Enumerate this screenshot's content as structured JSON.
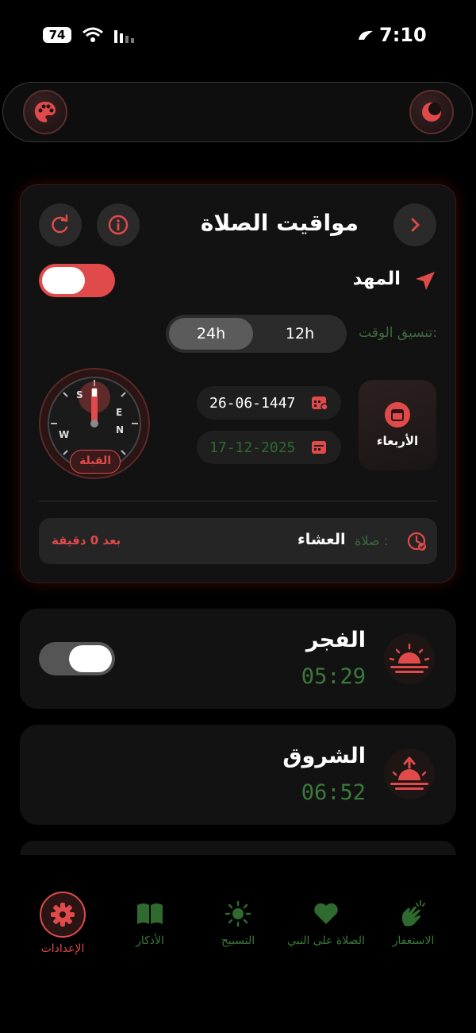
{
  "status_bar": {
    "battery": "74",
    "time": "7:10"
  },
  "header": {
    "title": "مواقيت الصلاة"
  },
  "location": {
    "name": "المهد",
    "auto_enabled": true
  },
  "time_format": {
    "label": "تنسيق الوقت:",
    "option_24": "24h",
    "option_12": "12h",
    "selected": "24h"
  },
  "dates": {
    "hijri": "26-06-1447",
    "gregorian": "17-12-2025",
    "weekday": "الأربعاء"
  },
  "qibla": {
    "label": "القبلة",
    "directions": [
      "S",
      "E",
      "N",
      "W"
    ]
  },
  "next_prayer": {
    "label": "صلاة :",
    "name": "العشاء",
    "remaining": "بعد 0 دقيقة"
  },
  "prayers": [
    {
      "name": "الفجر",
      "time": "05:29",
      "alert_on": true
    },
    {
      "name": "الشروق",
      "time": "06:52"
    }
  ],
  "bottom_nav": [
    {
      "label": "الإعدادات",
      "icon": "gear-icon",
      "active": true
    },
    {
      "label": "الأذكار",
      "icon": "book-icon"
    },
    {
      "label": "التسبيح",
      "icon": "sun-icon"
    },
    {
      "label": "الصلاة على النبي",
      "icon": "heart-icon"
    },
    {
      "label": "الاستغفار",
      "icon": "hands-icon"
    }
  ],
  "colors": {
    "accent": "#e04a4a",
    "green": "#3a7a3a",
    "card": "#121212"
  }
}
